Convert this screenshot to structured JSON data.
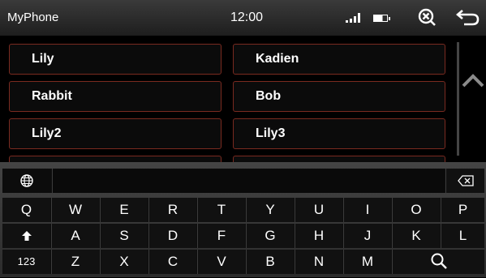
{
  "status": {
    "app_title": "MyPhone",
    "time": "12:00",
    "icons": [
      "signal-icon",
      "battery-icon",
      "close-icon",
      "back-icon"
    ]
  },
  "contacts": [
    {
      "name": "Lily"
    },
    {
      "name": "Kadien"
    },
    {
      "name": "Rabbit"
    },
    {
      "name": "Bob"
    },
    {
      "name": "Lily2"
    },
    {
      "name": "Lily3"
    }
  ],
  "keyboard": {
    "row0_special_icons": [
      "globe-icon",
      "backspace-icon"
    ],
    "row1": [
      "Q",
      "W",
      "E",
      "R",
      "T",
      "Y",
      "U",
      "I",
      "O",
      "P"
    ],
    "row2": [
      "A",
      "S",
      "D",
      "F",
      "G",
      "H",
      "J",
      "K",
      "L"
    ],
    "row3": [
      "Z",
      "X",
      "C",
      "V",
      "B",
      "N",
      "M"
    ],
    "numbers_label": "123",
    "icons": [
      "shift-icon",
      "search-icon"
    ]
  },
  "colors": {
    "accent": "#7a2a20",
    "background": "#000000"
  }
}
